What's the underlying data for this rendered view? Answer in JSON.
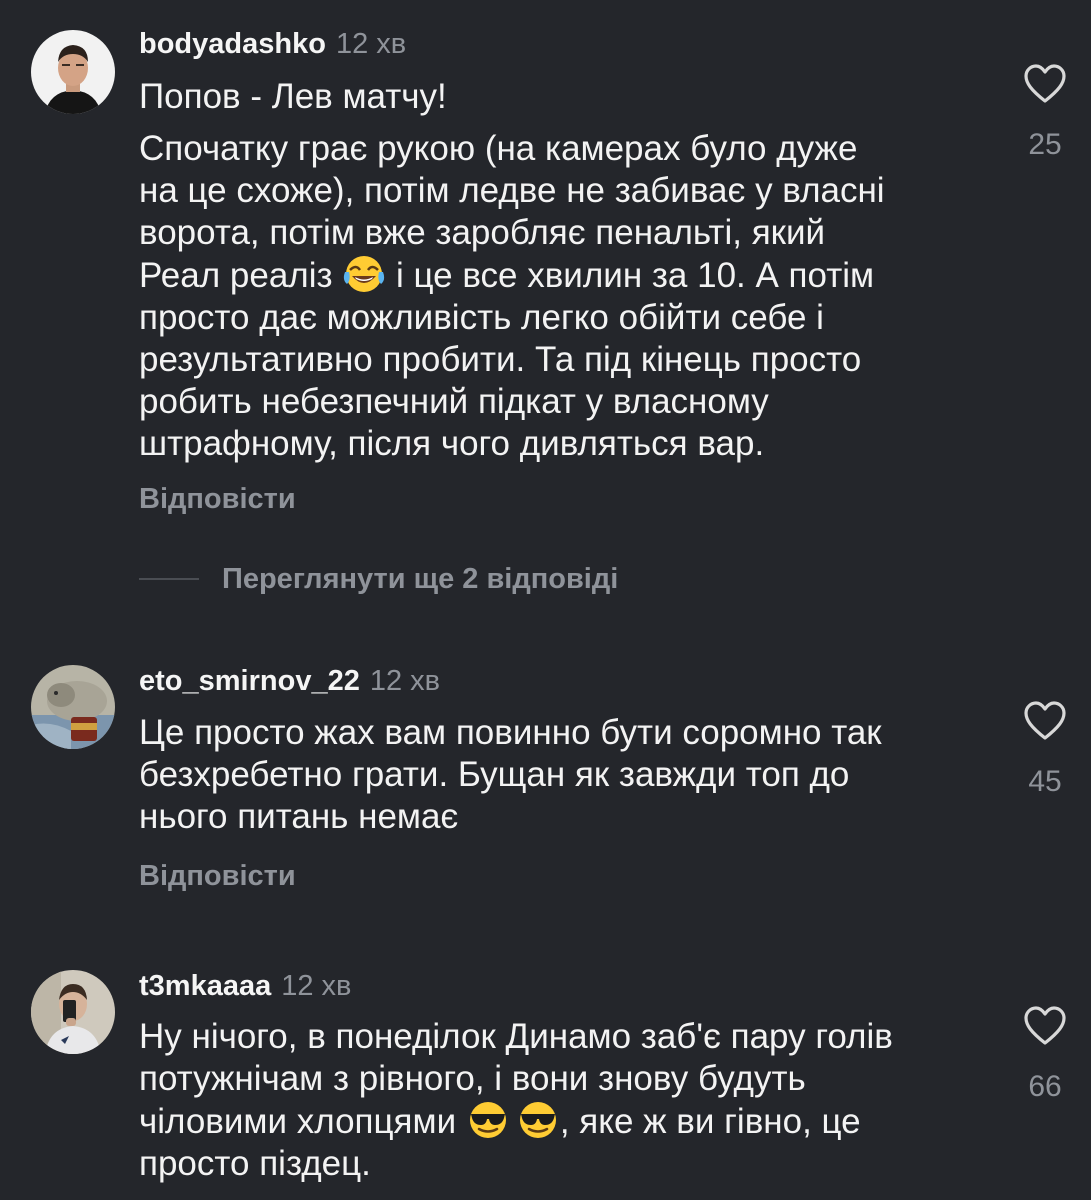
{
  "comments": [
    {
      "username": "bodyadashko",
      "time": "12 хв",
      "line1": "Попов - Лев матчу!",
      "text_before_emoji": "Спочатку грає рукою (на камерах було дуже\nна це схоже), потім ледве не забиває у власні\nворота, потім вже заробляє пенальті, який\nРеал реаліз ",
      "emoji": "face-with-tears-of-joy",
      "text_after_emoji": " і це все хвилин за 10. А потім\nпросто дає можливість легко обійти себе і\nрезультативно пробити. Та під кінець просто\nробить небезпечний підкат у власному\nштрафному, після чого дивляться вар.",
      "reply_label": "Відповісти",
      "likes": "25",
      "more_replies": "Переглянути ще 2 відповіді"
    },
    {
      "username": "eto_smirnov_22",
      "time": "12 хв",
      "text": "Це просто жах вам повинно бути соромно так\nбезхребетно грати. Бущан як завжди топ до\nнього питань немає",
      "reply_label": "Відповісти",
      "likes": "45"
    },
    {
      "username": "t3mkaaaa",
      "time": "12 хв",
      "text_before_emoji": "Ну нічого, в понеділок Динамо заб'є пару голів\nпотужнічам з рівного, і вони знову будуть\nчіловими хлопцями ",
      "emoji": "smiling-face-with-sunglasses",
      "text_after_emoji": ", яке ж ви гівно, це\nпросто піздец.",
      "likes": "66"
    }
  ],
  "colors": {
    "background": "#24262b",
    "text": "#f3f3f3",
    "muted": "#8f939a"
  }
}
